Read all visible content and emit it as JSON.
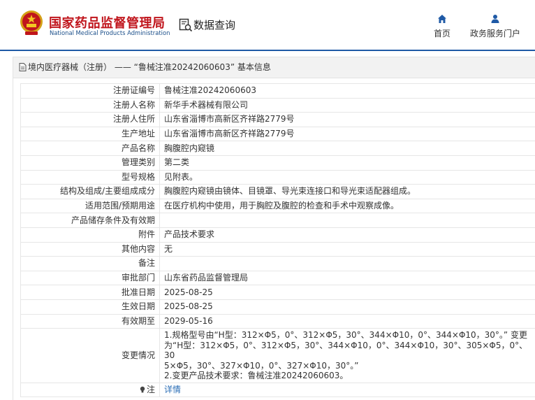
{
  "header": {
    "org_cn": "国家药品监督管理局",
    "org_en": "National Medical Products Administration",
    "query_title": "数据查询",
    "nav": [
      {
        "label": "首页",
        "icon": "home-icon"
      },
      {
        "label": "政务服务门户",
        "icon": "user-icon"
      }
    ]
  },
  "panel": {
    "title": "境内医疗器械（注册） —— “鲁械注准20242060603” 基本信息"
  },
  "rows": [
    {
      "label": "注册证编号",
      "value": "鲁械注准20242060603"
    },
    {
      "label": "注册人名称",
      "value": "新华手术器械有限公司"
    },
    {
      "label": "注册人住所",
      "value": "山东省淄博市高新区齐祥路2779号"
    },
    {
      "label": "生产地址",
      "value": "山东省淄博市高新区齐祥路2779号"
    },
    {
      "label": "产品名称",
      "value": "胸腹腔内窥镜"
    },
    {
      "label": "管理类别",
      "value": "第二类"
    },
    {
      "label": "型号规格",
      "value": "见附表。"
    },
    {
      "label": "结构及组成/主要组成成分",
      "value": "胸腹腔内窥镜由镜体、目镜罩、导光束连接口和导光束适配器组成。"
    },
    {
      "label": "适用范围/预期用途",
      "value": "在医疗机构中使用，用于胸腔及腹腔的检查和手术中观察成像。"
    },
    {
      "label": "产品储存条件及有效期",
      "value": ""
    },
    {
      "label": "附件",
      "value": "产品技术要求"
    },
    {
      "label": "其他内容",
      "value": "无"
    },
    {
      "label": "备注",
      "value": ""
    },
    {
      "label": "审批部门",
      "value": "山东省药品监督管理局"
    },
    {
      "label": "批准日期",
      "value": "2025-08-25"
    },
    {
      "label": "生效日期",
      "value": "2025-08-25"
    },
    {
      "label": "有效期至",
      "value": "2029-05-16"
    }
  ],
  "change": {
    "label": "变更情况",
    "lines": [
      "1.规格型号由“H型：312×Φ5，0°、312×Φ5，30°、344×Φ10，0°、344×Φ10，30°。” 变更",
      "为“H型：312×Φ5，0°、312×Φ5，30°、344×Φ10，0°、344×Φ10，30°、305×Φ5，0°、30",
      "5×Φ5，30°、327×Φ10，0°、327×Φ10，30°。”",
      "2.变更产品技术要求：鲁械注准20242060603。"
    ]
  },
  "note": {
    "label": "注",
    "link": "详情"
  },
  "colors": {
    "brand_red": "#c0151c",
    "brand_blue": "#1f5aa6",
    "link": "#2a6db5"
  }
}
